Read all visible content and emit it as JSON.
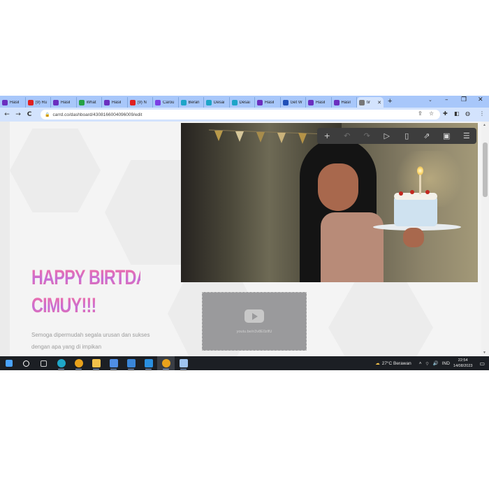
{
  "browser": {
    "tabs": [
      {
        "label": "Hasil",
        "favicon": "yahoo-icon",
        "color": "#6b2fbf"
      },
      {
        "label": "(9) Ru",
        "favicon": "youtube-icon",
        "color": "#e02020"
      },
      {
        "label": "Hasil",
        "favicon": "yahoo-icon",
        "color": "#6b2fbf"
      },
      {
        "label": "What",
        "favicon": "whatsapp-icon",
        "color": "#25a244"
      },
      {
        "label": "Hasil",
        "favicon": "yahoo-icon",
        "color": "#6b2fbf"
      },
      {
        "label": "(9) N",
        "favicon": "youtube-icon",
        "color": "#e02020"
      },
      {
        "label": "Carou",
        "favicon": "bootstrap-icon",
        "color": "#7b3fe4"
      },
      {
        "label": "Beran",
        "favicon": "canva-icon",
        "color": "#1ea5c8"
      },
      {
        "label": "Desai",
        "favicon": "canva-icon",
        "color": "#1ea5c8"
      },
      {
        "label": "Desai",
        "favicon": "canva-icon",
        "color": "#1ea5c8"
      },
      {
        "label": "Hasil",
        "favicon": "yahoo-icon",
        "color": "#6b2fbf"
      },
      {
        "label": "Get W",
        "favicon": "globe-icon",
        "color": "#2050b8"
      },
      {
        "label": "Hasil",
        "favicon": "yahoo-icon",
        "color": "#6b2fbf"
      },
      {
        "label": "Hasil",
        "favicon": "yahoo-icon",
        "color": "#6b2fbf"
      },
      {
        "label": "tir",
        "favicon": "carrd-icon",
        "color": "#777777",
        "active": true
      }
    ],
    "new_tab_glyph": "+",
    "url": "carrd.co/dashboard/4308166004096009/edit",
    "nav": {
      "back": "←",
      "forward": "→",
      "reload": "C"
    }
  },
  "editor_toolbar": {
    "buttons": [
      {
        "name": "add-icon",
        "glyph": "+",
        "enabled": true
      },
      {
        "name": "undo-icon",
        "glyph": "↶",
        "enabled": false
      },
      {
        "name": "redo-icon",
        "glyph": "↷",
        "enabled": false
      },
      {
        "name": "play-icon",
        "glyph": "▷",
        "enabled": true
      },
      {
        "name": "mobile-preview-icon",
        "glyph": "▯",
        "enabled": true
      },
      {
        "name": "publish-icon",
        "glyph": "⇗",
        "enabled": true
      },
      {
        "name": "save-icon",
        "glyph": "▣",
        "enabled": true
      },
      {
        "name": "menu-icon",
        "glyph": "☰",
        "enabled": true
      }
    ]
  },
  "site": {
    "headline_line1": "HAPPY BIRTDAY",
    "headline_line2": "CIMUY!!!",
    "subtext_line1": "Semoga dipermudah segala urusan dan sukses",
    "subtext_line2": "dengan apa yang di impikan",
    "video_url": "youtu.be/n3v8E0zlfU"
  },
  "taskbar": {
    "weather": "27°C  Berawan",
    "language": "IND",
    "time": "22:54",
    "date": "14/08/2023",
    "apps": [
      {
        "name": "start-icon",
        "color": "#4aa3ff"
      },
      {
        "name": "search-icon",
        "color": "#ffffff"
      },
      {
        "name": "task-view-icon",
        "color": "#cfcfcf"
      },
      {
        "name": "edge-icon",
        "color": "#1fa7c9"
      },
      {
        "name": "chrome-icon",
        "color": "#e8a21c"
      },
      {
        "name": "file-explorer-icon",
        "color": "#f2c14a"
      },
      {
        "name": "store-icon",
        "color": "#4f8ee6"
      },
      {
        "name": "mail-icon",
        "color": "#3a86d9"
      },
      {
        "name": "vscode-icon",
        "color": "#2a8fe0"
      },
      {
        "name": "chrome-active-icon",
        "color": "#e8a21c"
      },
      {
        "name": "notepad-icon",
        "color": "#9fc4f0"
      }
    ]
  }
}
